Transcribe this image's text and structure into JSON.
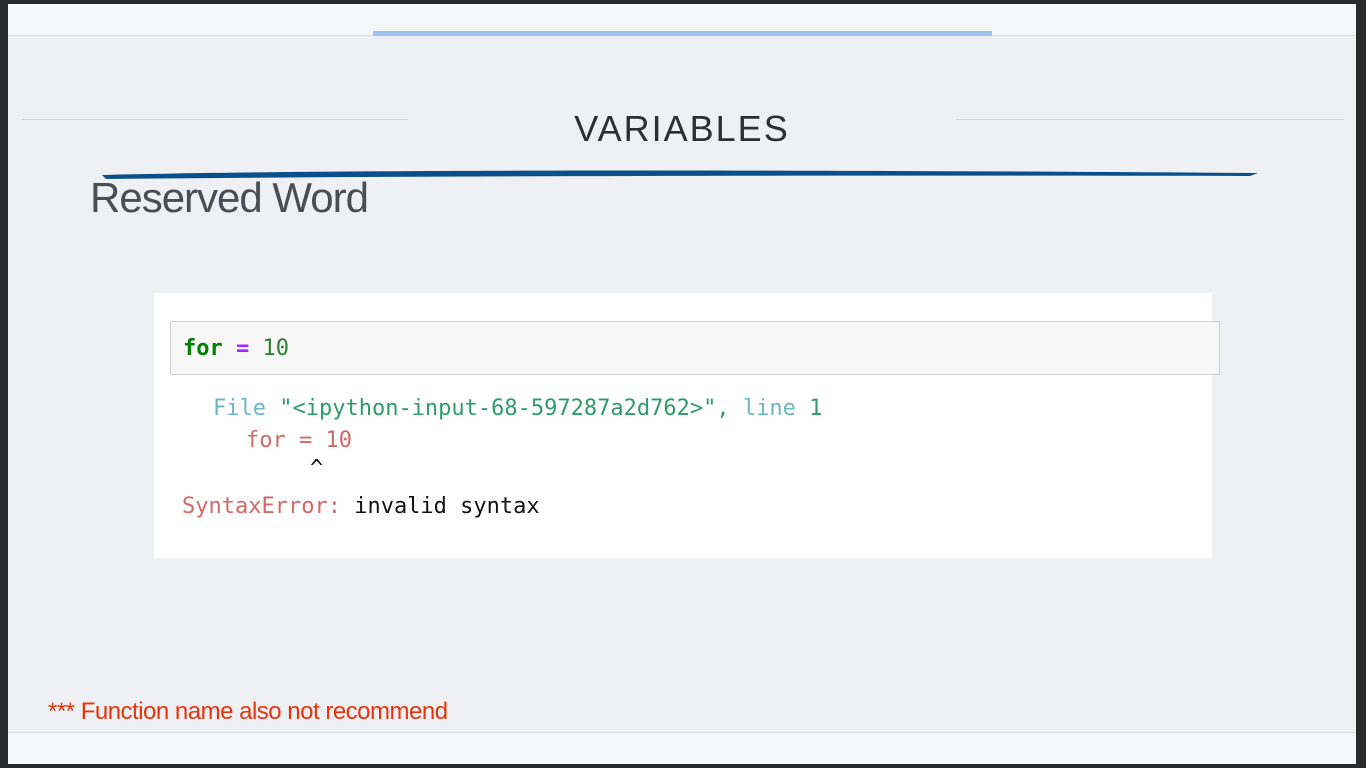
{
  "slide": {
    "title": "VARIABLES",
    "heading": "Reserved Word",
    "footnote": "*** Function name also not recommend"
  },
  "code": {
    "input": {
      "keyword": "for",
      "operator": "=",
      "number": "10"
    },
    "traceback": {
      "file_label": "File",
      "file_path": "\"<ipython-input-68-597287a2d762>\"",
      "comma": ",",
      "line_label": "line",
      "line_number": "1",
      "source_line": "for = 10",
      "caret": "^",
      "error_type": "SyntaxError:",
      "error_message": "invalid syntax"
    }
  },
  "colors": {
    "accent_blue": "#9cc4ef",
    "brush_blue": "#0b4f8a",
    "footnote_red": "#e8340c"
  }
}
